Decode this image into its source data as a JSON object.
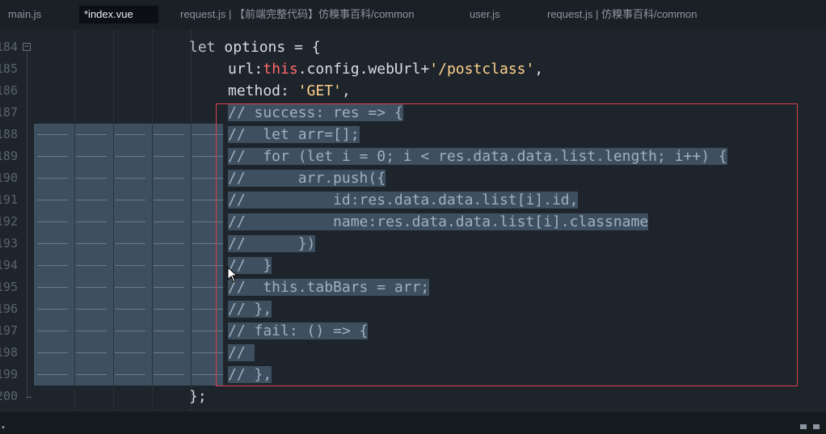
{
  "tabs": [
    {
      "label": "main.js",
      "active": false
    },
    {
      "label": "*index.vue",
      "active": true
    },
    {
      "label": "request.js | 【前端完整代码】仿糗事百科/common",
      "active": false
    },
    {
      "label": "user.js",
      "active": false
    },
    {
      "label": "request.js | 仿糗事百科/common",
      "active": false
    }
  ],
  "editor": {
    "line_numbers": [
      "184",
      "185",
      "186",
      "187",
      "188",
      "189",
      "190",
      "191",
      "192",
      "193",
      "194",
      "195",
      "196",
      "197",
      "198",
      "199",
      "200"
    ],
    "code_lines": [
      "let options = {",
      "    url:this.config.webUrl+'/postclass',",
      "    method: 'GET',",
      "// success: res => {",
      "//  let arr=[];",
      "//  for (let i = 0; i < res.data.data.list.length; i++) {",
      "//      arr.push({",
      "//          id:res.data.data.list[i].id,",
      "//          name:res.data.data.list[i].classname",
      "//      })",
      "//  }",
      "//  this.tabBars = arr;",
      "// },",
      "// fail: () => {",
      "// ",
      "// },",
      "};"
    ]
  },
  "colors": {
    "background": "#1e242b",
    "selection": "#3e4f5f",
    "highlight_box": "#d9424a",
    "keyword_this": "#ff6a6a",
    "string": "#ffd28a"
  }
}
